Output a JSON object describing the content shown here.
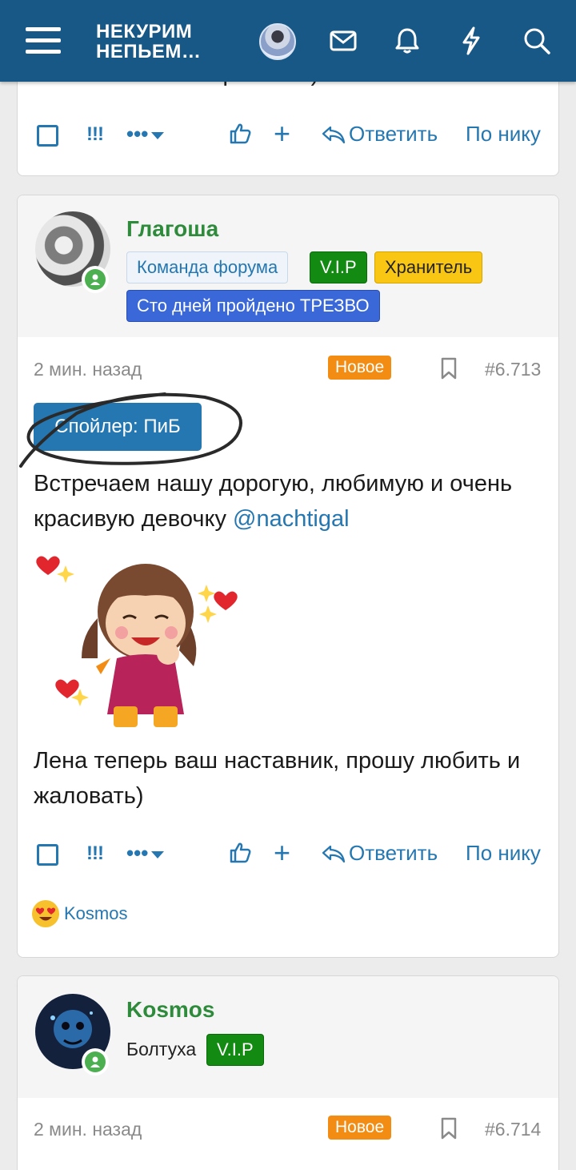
{
  "header": {
    "logo_line1": "НЕКУРИМ",
    "logo_line2": "НЕПЬЕМ…"
  },
  "prev_post": {
    "text_tail": "А потом как завертелось)",
    "actions": {
      "exclaim": "!!!",
      "more": "•••",
      "plus": "+",
      "reply": "Ответить",
      "by_nick": "По нику"
    }
  },
  "post": {
    "author": "Глагоша",
    "badges": [
      "Команда форума",
      "V.I.P",
      "Хранитель",
      "Сто дней пройдено ТРЕЗВО"
    ],
    "time": "2 мин. назад",
    "new_label": "Новое",
    "number": "#6.713",
    "spoiler": "Спойлер: ПиБ",
    "text1": "Встречаем нашу дорогую, любимую и очень красивую девочку ",
    "mention": "@nachtigal",
    "text2": "Лена теперь ваш наставник, прошу любить и жаловать)",
    "actions": {
      "exclaim": "!!!",
      "more": "•••",
      "plus": "+",
      "reply": "Ответить",
      "by_nick": "По нику"
    },
    "reaction_user": "Kosmos"
  },
  "next_post": {
    "author": "Kosmos",
    "title": "Болтуха",
    "badge": "V.I.P",
    "time": "2 мин. назад",
    "new_label": "Новое",
    "number": "#6.714"
  },
  "colors": {
    "header_bg": "#185886",
    "link": "#2577b1",
    "username": "#2e8b3b",
    "new_badge": "#f28c13",
    "vip_badge": "#138a11",
    "keeper_badge": "#f9c613",
    "sobriety_badge": "#3b68d8"
  }
}
